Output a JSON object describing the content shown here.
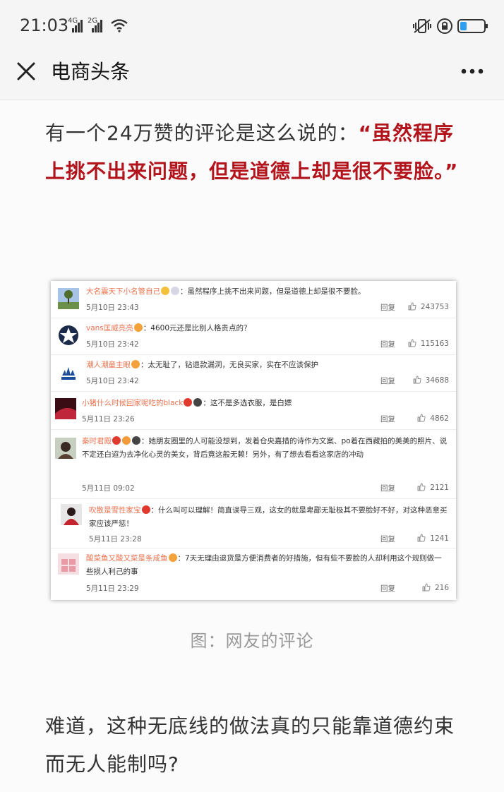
{
  "status_bar": {
    "time": "21:03",
    "network_1": "4G",
    "network_2": "2G"
  },
  "nav": {
    "title": "电商头条"
  },
  "article": {
    "para1_plain": "有一个24万赞的评论是这么说的：",
    "para1_quote": "“虽然程序上挑不出来问题，但是道德上却是很不要脸。”",
    "caption": "图：网友的评论",
    "para2": "难道，这种无底线的做法真的只能靠道德约束而无人能制吗?"
  },
  "comments": [
    {
      "name": "大名震天下小名管自己",
      "text": "：虽然程序上挑不出来问题，但是道德上却是很不要脸。",
      "date": "5月10日 23:43",
      "reply": "回复",
      "likes": "243753"
    },
    {
      "name": "vans匡威亮亮",
      "text": "：4600元还是比别人格贵点的？",
      "date": "5月10日 23:42",
      "reply": "回复",
      "likes": "115163"
    },
    {
      "name": "潮人潮童主眼",
      "text": "：太无耻了，钻退款漏洞，无良买家，实在不应该保护",
      "date": "5月10日 23:42",
      "reply": "回复",
      "likes": "34688"
    },
    {
      "name": "小猪什么时候回家呢吃的black",
      "text": "：这不是多选衣服，是白嫖",
      "date": "5月11日 23:26",
      "reply": "回复",
      "likes": "4862"
    },
    {
      "name": "秦时君殿",
      "text": "：她朋友圈里的人可能没想到，发着仓央嘉措的诗作为文案、po着在西藏拍的美美的照片、说不定还白迢为去净化心灵的美女，背后竟这般无赖！另外，有了想去看看这家店的冲动",
      "date": "5月11日 09:02",
      "reply": "回复",
      "likes": "2121"
    },
    {
      "name": "吹散是雪性家宝",
      "text": "：什么叫可以理解！简直误导三观，这女的就是卑鄙无耻极其不要脸好不好，对这种恶意买家应该严惩！",
      "date": "5月11日 23:28",
      "reply": "回复",
      "likes": "1241"
    },
    {
      "name": "酸菜鱼又酸又菜是条咸鱼",
      "text": "：7天无理由退货是方便消费者的好措施，但有些不要脸的人却利用这个规则做一些损人利己的事",
      "date": "5月11日 23:29",
      "reply": "回复",
      "likes": "216"
    }
  ],
  "colors": {
    "quote_red": "#b3141c",
    "weibo_name": "#eb7350"
  }
}
